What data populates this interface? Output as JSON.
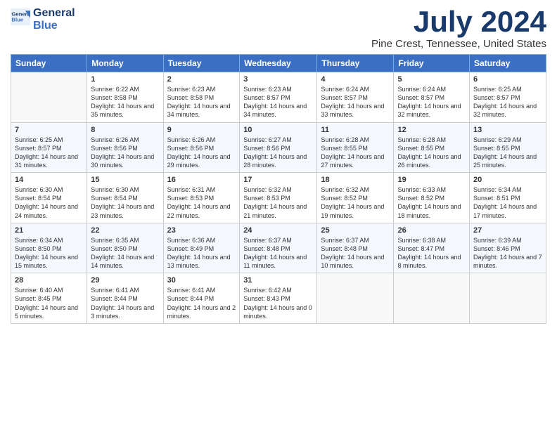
{
  "header": {
    "logo_line1": "General",
    "logo_line2": "Blue",
    "month_title": "July 2024",
    "location": "Pine Crest, Tennessee, United States"
  },
  "calendar": {
    "headers": [
      "Sunday",
      "Monday",
      "Tuesday",
      "Wednesday",
      "Thursday",
      "Friday",
      "Saturday"
    ],
    "weeks": [
      [
        {
          "day": "",
          "empty": true
        },
        {
          "day": "1",
          "sunrise": "6:22 AM",
          "sunset": "8:58 PM",
          "daylight": "14 hours and 35 minutes."
        },
        {
          "day": "2",
          "sunrise": "6:23 AM",
          "sunset": "8:58 PM",
          "daylight": "14 hours and 34 minutes."
        },
        {
          "day": "3",
          "sunrise": "6:23 AM",
          "sunset": "8:57 PM",
          "daylight": "14 hours and 34 minutes."
        },
        {
          "day": "4",
          "sunrise": "6:24 AM",
          "sunset": "8:57 PM",
          "daylight": "14 hours and 33 minutes."
        },
        {
          "day": "5",
          "sunrise": "6:24 AM",
          "sunset": "8:57 PM",
          "daylight": "14 hours and 32 minutes."
        },
        {
          "day": "6",
          "sunrise": "6:25 AM",
          "sunset": "8:57 PM",
          "daylight": "14 hours and 32 minutes."
        }
      ],
      [
        {
          "day": "7",
          "sunrise": "6:25 AM",
          "sunset": "8:57 PM",
          "daylight": "14 hours and 31 minutes."
        },
        {
          "day": "8",
          "sunrise": "6:26 AM",
          "sunset": "8:56 PM",
          "daylight": "14 hours and 30 minutes."
        },
        {
          "day": "9",
          "sunrise": "6:26 AM",
          "sunset": "8:56 PM",
          "daylight": "14 hours and 29 minutes."
        },
        {
          "day": "10",
          "sunrise": "6:27 AM",
          "sunset": "8:56 PM",
          "daylight": "14 hours and 28 minutes."
        },
        {
          "day": "11",
          "sunrise": "6:28 AM",
          "sunset": "8:55 PM",
          "daylight": "14 hours and 27 minutes."
        },
        {
          "day": "12",
          "sunrise": "6:28 AM",
          "sunset": "8:55 PM",
          "daylight": "14 hours and 26 minutes."
        },
        {
          "day": "13",
          "sunrise": "6:29 AM",
          "sunset": "8:55 PM",
          "daylight": "14 hours and 25 minutes."
        }
      ],
      [
        {
          "day": "14",
          "sunrise": "6:30 AM",
          "sunset": "8:54 PM",
          "daylight": "14 hours and 24 minutes."
        },
        {
          "day": "15",
          "sunrise": "6:30 AM",
          "sunset": "8:54 PM",
          "daylight": "14 hours and 23 minutes."
        },
        {
          "day": "16",
          "sunrise": "6:31 AM",
          "sunset": "8:53 PM",
          "daylight": "14 hours and 22 minutes."
        },
        {
          "day": "17",
          "sunrise": "6:32 AM",
          "sunset": "8:53 PM",
          "daylight": "14 hours and 21 minutes."
        },
        {
          "day": "18",
          "sunrise": "6:32 AM",
          "sunset": "8:52 PM",
          "daylight": "14 hours and 19 minutes."
        },
        {
          "day": "19",
          "sunrise": "6:33 AM",
          "sunset": "8:52 PM",
          "daylight": "14 hours and 18 minutes."
        },
        {
          "day": "20",
          "sunrise": "6:34 AM",
          "sunset": "8:51 PM",
          "daylight": "14 hours and 17 minutes."
        }
      ],
      [
        {
          "day": "21",
          "sunrise": "6:34 AM",
          "sunset": "8:50 PM",
          "daylight": "14 hours and 15 minutes."
        },
        {
          "day": "22",
          "sunrise": "6:35 AM",
          "sunset": "8:50 PM",
          "daylight": "14 hours and 14 minutes."
        },
        {
          "day": "23",
          "sunrise": "6:36 AM",
          "sunset": "8:49 PM",
          "daylight": "14 hours and 13 minutes."
        },
        {
          "day": "24",
          "sunrise": "6:37 AM",
          "sunset": "8:48 PM",
          "daylight": "14 hours and 11 minutes."
        },
        {
          "day": "25",
          "sunrise": "6:37 AM",
          "sunset": "8:48 PM",
          "daylight": "14 hours and 10 minutes."
        },
        {
          "day": "26",
          "sunrise": "6:38 AM",
          "sunset": "8:47 PM",
          "daylight": "14 hours and 8 minutes."
        },
        {
          "day": "27",
          "sunrise": "6:39 AM",
          "sunset": "8:46 PM",
          "daylight": "14 hours and 7 minutes."
        }
      ],
      [
        {
          "day": "28",
          "sunrise": "6:40 AM",
          "sunset": "8:45 PM",
          "daylight": "14 hours and 5 minutes."
        },
        {
          "day": "29",
          "sunrise": "6:41 AM",
          "sunset": "8:44 PM",
          "daylight": "14 hours and 3 minutes."
        },
        {
          "day": "30",
          "sunrise": "6:41 AM",
          "sunset": "8:44 PM",
          "daylight": "14 hours and 2 minutes."
        },
        {
          "day": "31",
          "sunrise": "6:42 AM",
          "sunset": "8:43 PM",
          "daylight": "14 hours and 0 minutes."
        },
        {
          "day": "",
          "empty": true
        },
        {
          "day": "",
          "empty": true
        },
        {
          "day": "",
          "empty": true
        }
      ]
    ]
  }
}
